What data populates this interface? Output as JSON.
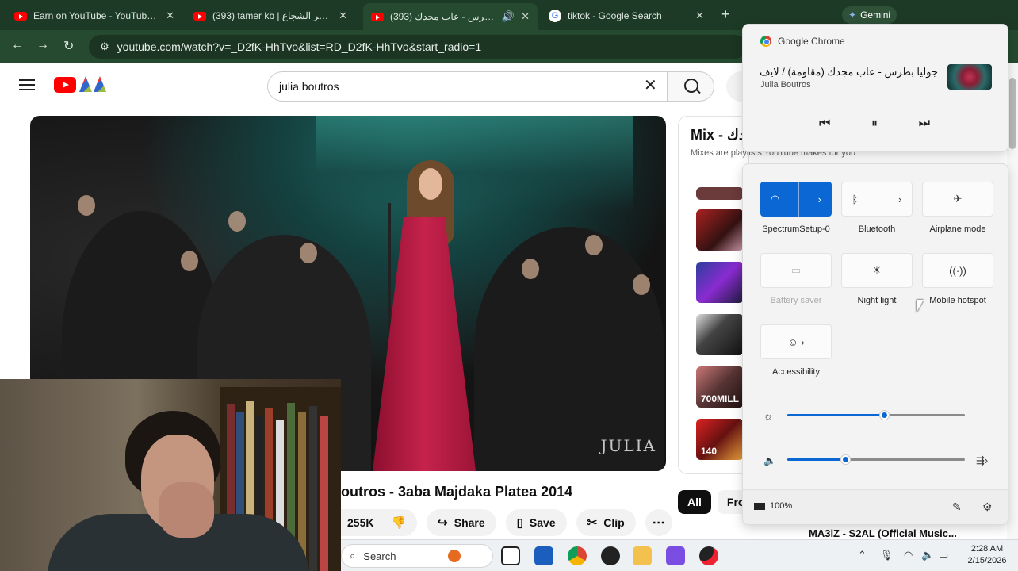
{
  "tabs": [
    {
      "title": "Earn on YouTube - YouTube Studio",
      "icon": "youtube-icon"
    },
    {
      "title": "(393) tamer kb | تامر الشجاع - YouTube",
      "icon": "youtube-icon"
    },
    {
      "title": "(393) جوليا بطرس - عاب مجدك",
      "icon": "youtube-icon",
      "active": true
    },
    {
      "title": "tiktok - Google Search",
      "icon": "google-icon"
    }
  ],
  "browser": {
    "url": "youtube.com/watch?v=_D2fK-HhTvo&list=RD_D2fK-HhTvo&start_radio=1",
    "gemini_label": "Gemini",
    "google_letter": "G"
  },
  "youtube": {
    "search_value": "julia boutros",
    "video_watermark": "JULIA",
    "video_title": "outros - 3aba Majdaka Platea 2014",
    "actions": {
      "likes": "255K",
      "share": "Share",
      "save": "Save",
      "clip": "Clip"
    },
    "mix_title": "Mix - عاب مجدك",
    "mix_subtitle": "Mixes are playlists YouTube makes for you",
    "thumb_labels": [
      "700MILL",
      "140"
    ],
    "chips": [
      "All",
      "From"
    ],
    "next_video_title": "MA3iZ - S2AL (Official Music..."
  },
  "media_flyout": {
    "source": "Google Chrome",
    "song": "جوليا بطرس - عاب مجدك (مقاومة) / لايف...",
    "artist": "Julia Boutros"
  },
  "quick_settings": {
    "tiles": [
      {
        "label": "SpectrumSetup-0",
        "icon": "wifi-icon",
        "on": true
      },
      {
        "label": "Bluetooth",
        "icon": "bluetooth-icon",
        "on": false
      },
      {
        "label": "Airplane mode",
        "icon": "airplane-icon",
        "on": false
      },
      {
        "label": "Battery saver",
        "icon": "battery-saver-icon",
        "disabled": true
      },
      {
        "label": "Night light",
        "icon": "night-light-icon",
        "on": false
      },
      {
        "label": "Mobile hotspot",
        "icon": "hotspot-icon",
        "on": false
      },
      {
        "label": "Accessibility",
        "icon": "accessibility-icon",
        "on": false
      }
    ],
    "brightness": 0.55,
    "volume": 0.33,
    "battery": "100%"
  },
  "taskbar": {
    "search_placeholder": "Search",
    "time": "2:28 AM",
    "date": "2/15/2026"
  },
  "colors": {
    "chrome_dark": "#1d3a26",
    "youtube_red": "#ff0000",
    "windows_accent": "#0a67d3"
  }
}
